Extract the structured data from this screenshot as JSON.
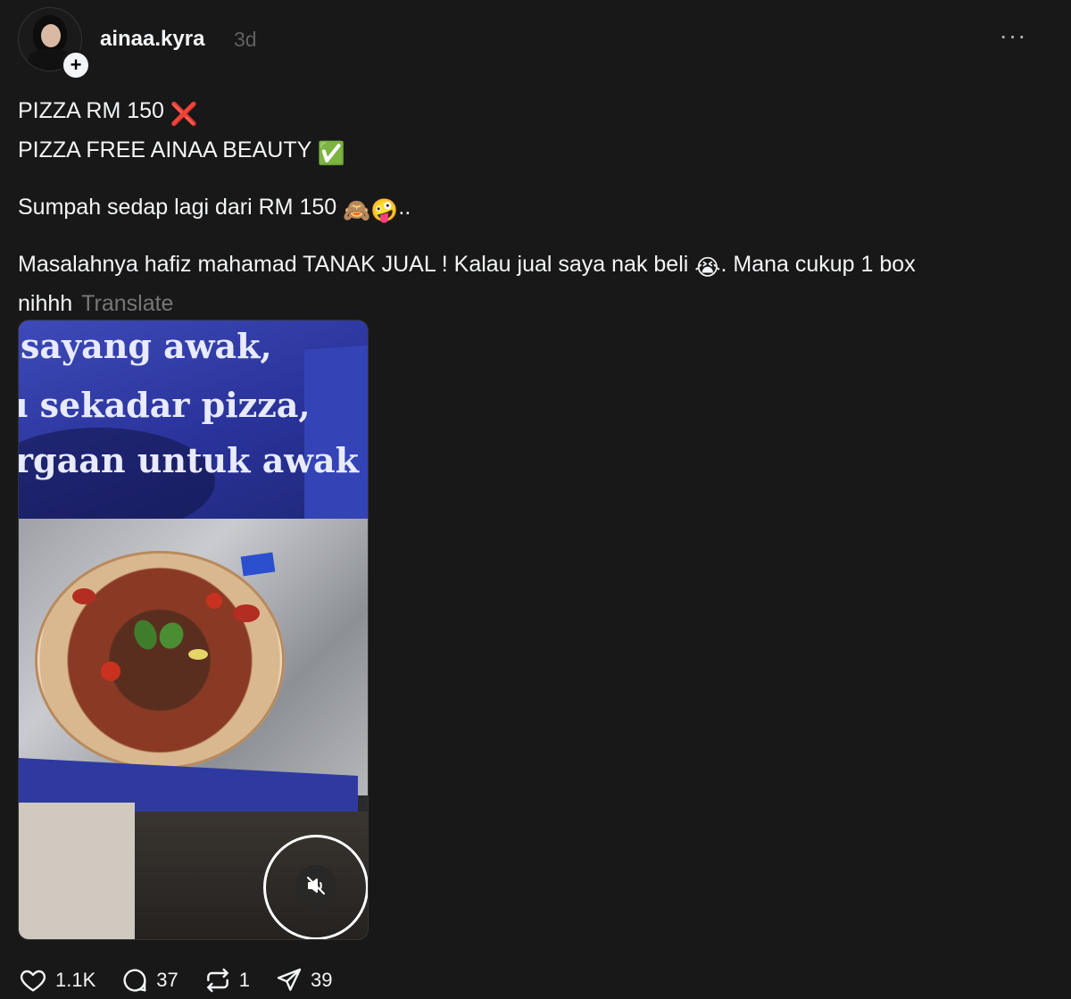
{
  "post": {
    "username": "ainaa.kyra",
    "timestamp": "3d",
    "more_label": "···",
    "caption": {
      "line1": "PIZZA RM 150",
      "line1_emoji": "❌",
      "line2": "PIZZA FREE AINAA BEAUTY",
      "line2_emoji": "✅",
      "line3": "Sumpah sedap lagi dari RM 150",
      "line3_emojis": "🙈🤪",
      "line3_suffix": "..",
      "line4_part1": "Masalahnya hafiz mahamad TANAK JUAL ! Kalau jual saya nak beli",
      "line4_emoji": "😭",
      "line4_part2": ". Mana cukup 1 box nihhh",
      "translate": "Translate"
    },
    "video": {
      "lid_text": [
        "sayang awak,",
        "ı sekadar pizza,",
        "rgaan untuk awak"
      ]
    },
    "actions": {
      "likes": "1.1K",
      "comments": "37",
      "reposts": "1",
      "shares": "39"
    }
  },
  "icons": {
    "follow": "plus-icon",
    "more": "more-icon",
    "like": "heart-icon",
    "comment": "comment-icon",
    "repost": "repost-icon",
    "share": "share-icon",
    "mute": "speaker-muted-icon"
  },
  "colors": {
    "background": "#181818",
    "text": "#f3f5f7",
    "muted": "#616161",
    "box_blue": "#2f3aa0"
  }
}
